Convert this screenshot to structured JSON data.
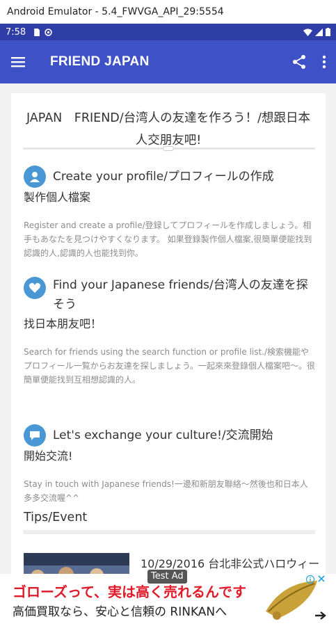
{
  "window": {
    "title": "Android Emulator - 5.4_FWVGA_API_29:5554"
  },
  "statusbar": {
    "time": "7:58"
  },
  "appbar": {
    "title": "FRIEND JAPAN"
  },
  "content": {
    "heading": "JAPAN　FRIEND/台湾人の友達を作ろう！/想跟日本人交朋友吧!",
    "features": [
      {
        "icon": "user-icon",
        "title": "Create your profile/プロフィールの作成",
        "subtitle": "製作個人檔案",
        "description": "Register and create a profile/登録してプロフィールを作成しましょう。相手もあなたを見つけやすくなります。 如果登錄製作個人檔案,很簡單便能找到認識的人,認識的人也能找到你。"
      },
      {
        "icon": "heart-icon",
        "title": "Find your Japanese friends/台湾人の友達を探そう",
        "subtitle": "找日本朋友吧！",
        "description": "Search for friends using the search function or profile list./検索機能やプロフィール一覧からお友達を探しましょう。一起來來登錄個人檔案吧〜。很簡單便能找到互相想認識的人。"
      },
      {
        "icon": "chat-icon",
        "title": "Let's exchange your culture!/交流開始",
        "subtitle": "開始交流!",
        "description": "Stay in touch with Japanese friends!一邊和新朋友聯絡〜然後也和日本人多多交流喔^^"
      }
    ],
    "tips_heading": "Tips/Event",
    "news": [
      {
        "text": "10/29/2016 台北非公式ハロウィー"
      }
    ]
  },
  "ad": {
    "badge": "Test Ad",
    "headline": "ゴローズって、実は高く売れるんです",
    "subline": "高価買取なら、安心と信頼の RINKANへ"
  },
  "colors": {
    "statusbar": "#2f3da6",
    "appbar": "#3f51c6",
    "feature_icon": "#4a97d6",
    "ad_headline": "#e11a2a"
  }
}
